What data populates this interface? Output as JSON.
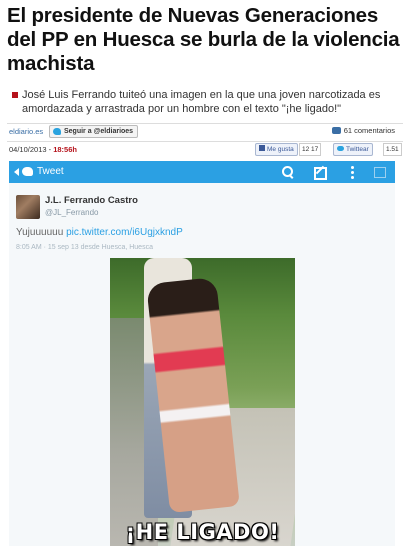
{
  "article": {
    "headline": "El presidente de Nuevas Generaciones del PP en Huesca se burla de la violencia machista",
    "lede": "José Luis Ferrando tuiteó una imagen en la que una joven narcotizada es amordazada y arrastrada por un hombre con el texto \"¡he ligado!\""
  },
  "share": {
    "site": "eldiario.es",
    "follow_label": "Seguir a @eldiarioes",
    "comments_count": "61",
    "comments_label": "comentarios",
    "date": "04/10/2013",
    "time": "18:56h",
    "facebook_label": "Me gusta",
    "facebook_count": "12 17",
    "twitter_label": "Twittear",
    "twitter_count": "1.51"
  },
  "tweet": {
    "bar_title": "Tweet",
    "user_name": "J.L. Ferrando Castro",
    "user_handle": "@JL_Ferrando",
    "text": "Yujuuuuuu",
    "link": "pic.twitter.com/i6UgjxkndP",
    "meta": "8:05 AM · 15 sep 13 desde Huesca, Huesca",
    "image_caption": "¡HE LIGADO!"
  },
  "colors": {
    "twitter_blue": "#2ba0e3",
    "accent_red": "#b5121b",
    "facebook_blue": "#3b5998"
  },
  "icons": [
    "back-icon",
    "twitter-bird-icon",
    "search-icon",
    "compose-icon",
    "menu-icon",
    "square-icon",
    "comment-bubble-icon",
    "facebook-like-icon"
  ]
}
